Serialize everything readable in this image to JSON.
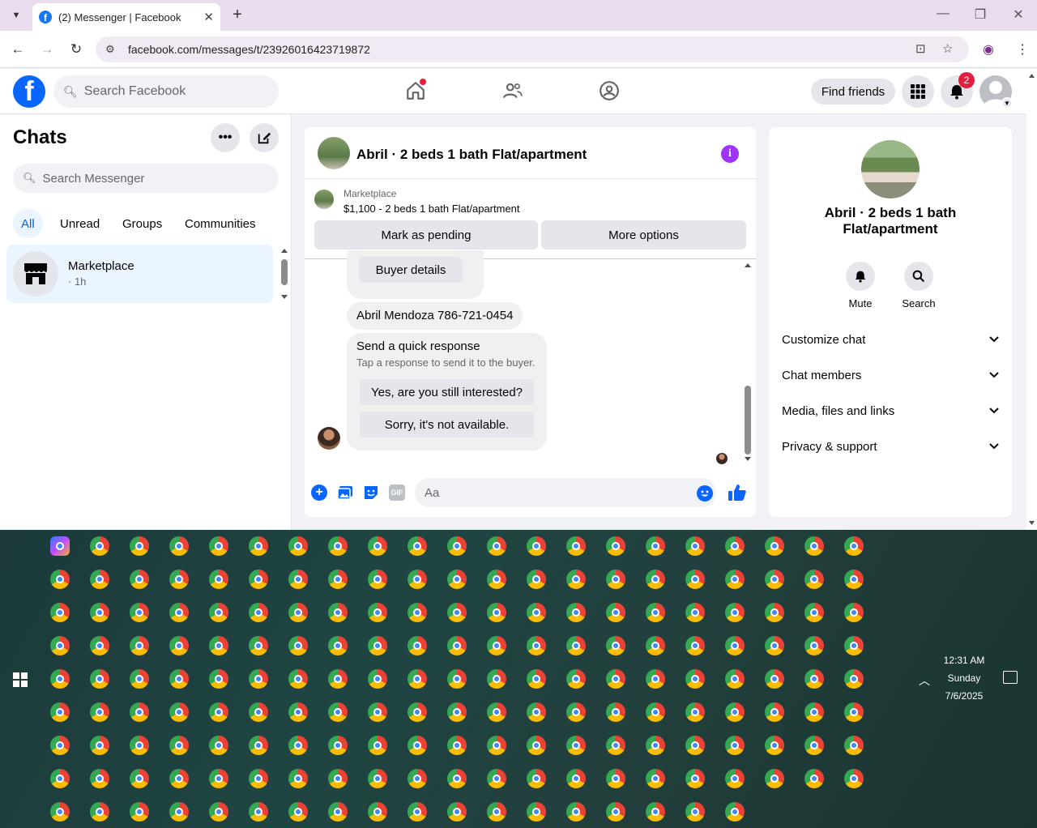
{
  "browser": {
    "tab_title": "(2) Messenger | Facebook",
    "url": "facebook.com/messages/t/23926016423719872"
  },
  "fb": {
    "search_placeholder": "Search Facebook",
    "find_friends": "Find friends",
    "notification_count": "2"
  },
  "sidebar": {
    "title": "Chats",
    "search_placeholder": "Search Messenger",
    "filters": [
      "All",
      "Unread",
      "Groups",
      "Communities"
    ],
    "chats": [
      {
        "name": "Marketplace",
        "time": "· 1h"
      }
    ]
  },
  "conversation": {
    "title": "Abril · 2 beds 1 bath Flat/apartment",
    "marketplace_label": "Marketplace",
    "listing": "$1,100 - 2 beds 1 bath Flat/apartment",
    "mark_pending": "Mark as pending",
    "more_options": "More options",
    "buyer_details": "Buyer details",
    "contact_message": "Abril Mendoza 786-721-0454",
    "quick_response_title": "Send a quick response",
    "quick_response_sub": "Tap a response to send it to the buyer.",
    "quick_responses": [
      "Yes, are you still interested?",
      "Sorry, it's not available."
    ],
    "composer_placeholder": "Aa"
  },
  "info_panel": {
    "title": "Abril · 2 beds 1 bath Flat/apartment",
    "actions": [
      "Mute",
      "Search"
    ],
    "sections": [
      "Customize chat",
      "Chat members",
      "Media, files and links",
      "Privacy & support"
    ]
  },
  "taskbar": {
    "time": "12:31 AM",
    "day": "Sunday",
    "date": "7/6/2025"
  },
  "colors": {
    "fb_blue": "#0866ff",
    "chat_selected": "#ebf5ff",
    "notif_red": "#e41e3f",
    "info_purple": "#a033ff"
  }
}
